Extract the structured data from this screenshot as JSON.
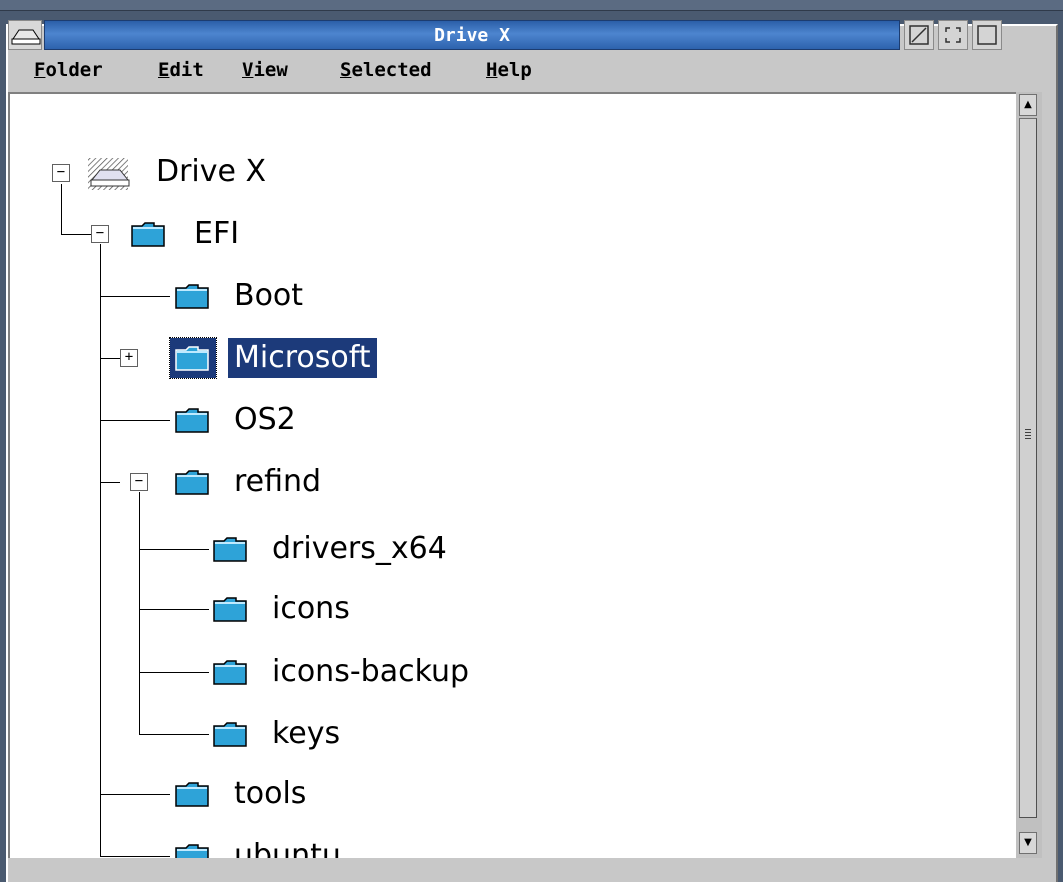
{
  "window": {
    "title": "Drive X"
  },
  "menubar": {
    "items": [
      {
        "label_key": "F",
        "label_rest": "older"
      },
      {
        "label_key": "E",
        "label_rest": "dit"
      },
      {
        "label_key": "V",
        "label_rest": "iew"
      },
      {
        "label_key": "S",
        "label_rest": "elected"
      },
      {
        "label_key": "H",
        "label_rest": "elp"
      }
    ]
  },
  "tree": {
    "root": "Drive X",
    "efi": "EFI",
    "boot": "Boot",
    "microsoft": "Microsoft",
    "os2": "OS2",
    "refind": "refind",
    "drivers": "drivers_x64",
    "icons": "icons",
    "icons_backup": "icons-backup",
    "keys": "keys",
    "tools": "tools",
    "ubuntu": "ubuntu"
  },
  "icons": {
    "drive": "drive-icon",
    "folder": "folder-icon"
  },
  "colors": {
    "title_bar": "#3a70bd",
    "selection": "#1c3a7a",
    "folder": "#2ea3d8"
  }
}
